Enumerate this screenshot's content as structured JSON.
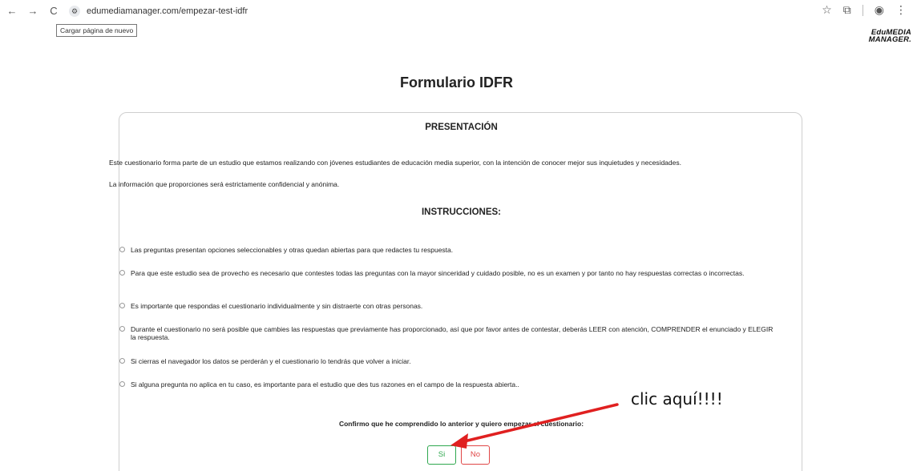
{
  "browser": {
    "url": "edumediamanager.com/empezar-test-idfr",
    "tooltip": "Cargar página de nuevo",
    "icons": [
      "back-icon",
      "forward-icon",
      "reload-icon",
      "site-settings-icon",
      "star-icon",
      "extensions-icon",
      "profile-icon",
      "menu-icon"
    ]
  },
  "brand": {
    "line1": "EduMEDIA",
    "line2": "MANAGER."
  },
  "form": {
    "title": "Formulario IDFR",
    "presentation_heading": "PRESENTACIÓN",
    "presentation_paragraphs": [
      "Este cuestionario forma parte de un estudio que estamos realizando con jóvenes estudiantes de educación media superior, con la intención de conocer mejor sus inquietudes y necesidades.",
      "La información que proporciones será estrictamente confidencial y anónima."
    ],
    "instructions_heading": "INSTRUCCIONES:",
    "instructions": [
      "Las preguntas presentan opciones seleccionables y otras quedan abiertas para que redactes tu respuesta.",
      "Para que este estudio sea de provecho es necesario que contestes todas las preguntas con la mayor sinceridad y cuidado posible, no es un examen y por tanto no hay respuestas correctas o incorrectas.",
      "Es importante que respondas el cuestionario individualmente y sin distraerte con otras personas.",
      "Durante el cuestionario no será posible que cambies las respuestas que previamente has proporcionado, así que por favor antes de contestar, deberás LEER con atención, COMPRENDER el enunciado y ELEGIR la respuesta.",
      "Si cierras el navegador los datos se perderán y el cuestionario lo tendrás que volver a iniciar.",
      "Si alguna pregunta no aplica en tu caso, es importante para el estudio que des tus razones en el campo de la respuesta abierta.."
    ],
    "confirm_text": "Confirmo que he comprendido lo anterior y quiero empezar el cuestionario:",
    "yes_label": "Si",
    "no_label": "No"
  },
  "annotation": {
    "text": "clic aquí!!!!",
    "color": "#e02020"
  },
  "colors": {
    "yes": "#2fa84f",
    "no": "#e04646"
  }
}
